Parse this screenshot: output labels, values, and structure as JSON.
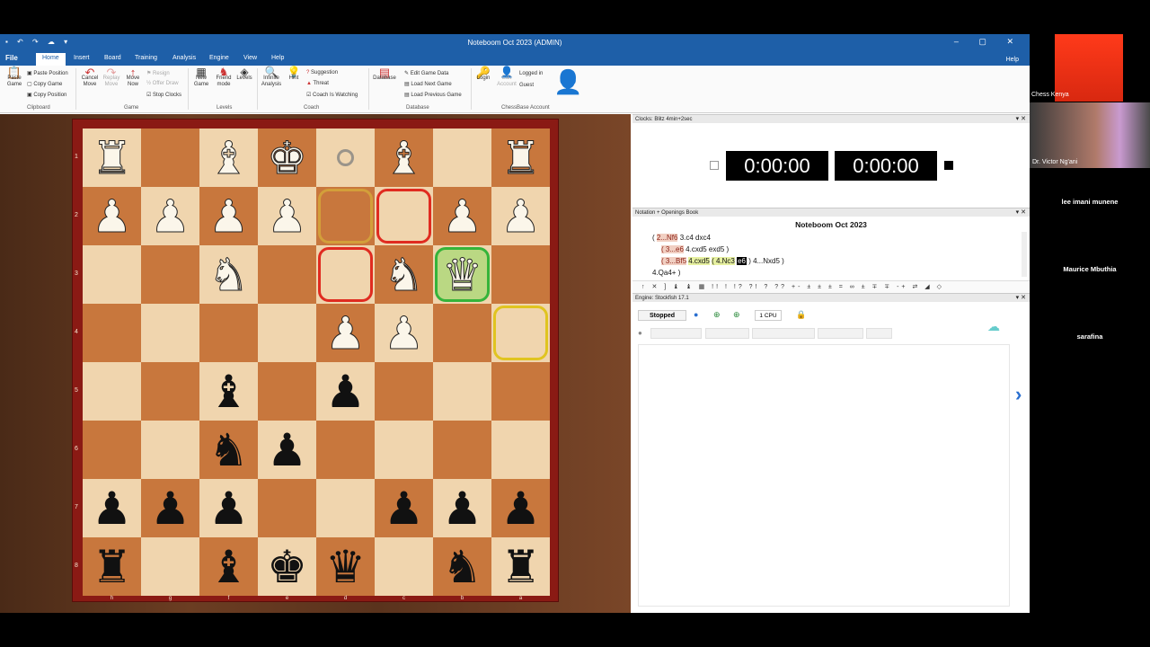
{
  "window": {
    "title": "Noteboom Oct 2023  (ADMIN)",
    "controls": [
      "–",
      "▢",
      "✕"
    ]
  },
  "menu": {
    "tabs": [
      "File",
      "Home",
      "Insert",
      "Board",
      "Training",
      "Analysis",
      "Engine",
      "View",
      "Help"
    ],
    "active": "Home",
    "help": "Help"
  },
  "ribbon": {
    "paste_game": "Paste Game",
    "paste_position": "Paste Position",
    "copy_game": "Copy Game",
    "copy_position": "Copy Position",
    "clipboard": "Clipboard",
    "cancel_move": "Cancel Move",
    "replay_move": "Replay Move",
    "move_now": "Move Now",
    "resign": "Resign",
    "offer_draw": "Offer Draw",
    "stop_clocks": "Stop Clocks",
    "game": "Game",
    "new_game": "New Game",
    "friend_mode": "Friend mode",
    "levels_btn": "Levels",
    "levels": "Levels",
    "infinite_analysis": "Infinite Analysis",
    "hint": "Hint",
    "suggestion": "Suggestion",
    "threat": "Threat",
    "coach_watching": "Coach Is Watching",
    "coach": "Coach",
    "database_btn": "Database",
    "edit_game_data": "Edit Game Data",
    "load_next_game": "Load Next Game",
    "load_previous_game": "Load Previous Game",
    "database": "Database",
    "login": "Login",
    "edit_account": "Edit Account",
    "logged_in": "Logged in",
    "guest": "Guest",
    "chessbase_account": "ChessBase Account"
  },
  "board": {
    "ranks": [
      "1",
      "2",
      "3",
      "4",
      "5",
      "6",
      "7",
      "8"
    ],
    "files": [
      "h",
      "g",
      "f",
      "e",
      "d",
      "c",
      "b",
      "a"
    ],
    "rows": [
      [
        "wR",
        "",
        "wB",
        "wK",
        "",
        "wB",
        "",
        "wR"
      ],
      [
        "wP",
        "wP",
        "wP",
        "wP",
        "",
        "",
        "wP",
        "wP"
      ],
      [
        "",
        "",
        "wN",
        "",
        "",
        "wN",
        "wQ",
        ""
      ],
      [
        "",
        "",
        "",
        "",
        "wP",
        "wP",
        "",
        ""
      ],
      [
        "",
        "",
        "bB",
        "",
        "bP",
        "",
        "",
        ""
      ],
      [
        "",
        "",
        "bN",
        "bP",
        "",
        "",
        "",
        ""
      ],
      [
        "bP",
        "bP",
        "bP",
        "",
        "",
        "bP",
        "bP",
        "bP"
      ],
      [
        "bR",
        "",
        "bB",
        "bK",
        "bQ",
        "",
        "bN",
        "bR"
      ]
    ]
  },
  "clocks": {
    "header": "Clocks: Blitz 4min+2sec",
    "white_time": "0:00:00",
    "black_time": "0:00:00"
  },
  "notation": {
    "header": "Notation + Openings Book",
    "title": "Noteboom Oct 2023",
    "line1_a": "2...Nf6",
    "line1_b": "3.c4  dxc4",
    "line2_a": "( 3...e6",
    "line2_b": "4.cxd5  exd5 )",
    "line3_a": "( 3...Bf5",
    "line3_b": "4.cxd5",
    "line3_c": "( 4.Nc3",
    "line3_d": "e6",
    "line3_e": ") 4...Nxd5 )",
    "line4": "4.Qa4+ )"
  },
  "symbols": "↑ ✕ ] ♝ ♝ ▦ !! ! !? ?! ? ?? +- ± ± ± = ∞ ± ∓ ∓ -+ ⇄ ◢ ◇",
  "engine": {
    "header": "Engine: Stockfish 17.1",
    "status": "Stopped",
    "cpu": "1 CPU"
  },
  "participants": {
    "video1": "Chess Kenya",
    "video2": "Dr. Victor Ng'ani",
    "names": [
      "lee imani munene",
      "Maurice Mbuthia",
      "sarafina"
    ]
  }
}
